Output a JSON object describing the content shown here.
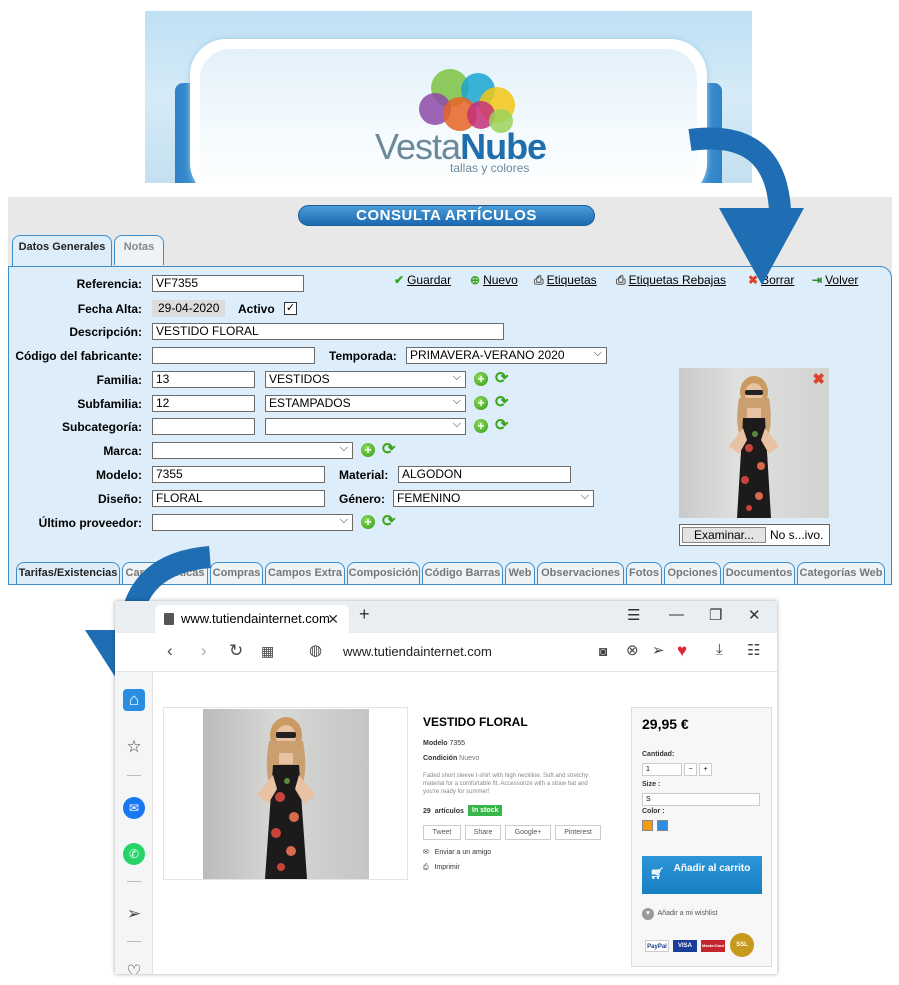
{
  "banner": {
    "brand_part1": "Vesta",
    "brand_part2": "Nube",
    "tagline": "tallas y colores"
  },
  "erp": {
    "title": "CONSULTA ARTÍCULOS",
    "tabs": [
      "Datos Generales",
      "Notas"
    ],
    "toolbar": {
      "guardar": "Guardar",
      "nuevo": "Nuevo",
      "etiquetas": "Etiquetas",
      "etiquetas_rebajas": "Etiquetas Rebajas",
      "borrar": "Borrar",
      "volver": "Volver"
    },
    "labels": {
      "referencia": "Referencia:",
      "fecha_alta": "Fecha Alta:",
      "activo": "Activo",
      "descripcion": "Descripción:",
      "codigo_fabricante": "Código del fabricante:",
      "temporada": "Temporada:",
      "familia": "Familia:",
      "subfamilia": "Subfamilia:",
      "subcategoria": "Subcategoría:",
      "marca": "Marca:",
      "modelo": "Modelo:",
      "material": "Material:",
      "diseno": "Diseño:",
      "genero": "Género:",
      "ultimo_proveedor": "Último proveedor:"
    },
    "values": {
      "referencia": "VF7355",
      "fecha_alta": "29-04-2020",
      "activo_checked": "✓",
      "descripcion": "VESTIDO FLORAL",
      "codigo_fabricante": "",
      "temporada": "PRIMAVERA-VERANO 2020",
      "familia_code": "13",
      "familia": "VESTIDOS",
      "subfamilia_code": "12",
      "subfamilia": "ESTAMPADOS",
      "subcategoria_code": "",
      "subcategoria": "",
      "marca": "",
      "modelo": "7355",
      "material": "ALGODON",
      "diseno": "FLORAL",
      "genero": "FEMENINO",
      "ultimo_proveedor": ""
    },
    "file": {
      "button": "Examinar...",
      "status": "No s...ivo."
    },
    "bottom_tabs": [
      "Tarifas/Existencias",
      "Características",
      "Compras",
      "Campos Extra",
      "Composición",
      "Código Barras",
      "Web",
      "Observaciones",
      "Fotos",
      "Opciones",
      "Documentos",
      "Categorías Web"
    ]
  },
  "browser": {
    "tab_title": "www.tutiendainternet.com",
    "url": "www.tutiendainternet.com",
    "product": {
      "title": "VESTIDO FLORAL",
      "modelo_label": "Modelo",
      "modelo_value": "7355",
      "condicion_label": "Condición",
      "condicion_value": "Nuevo",
      "description": "Faded short sleeve t-shirt with high neckline. Soft and stretchy material for a comfortable fit. Accessorize with a straw hat and you're ready for summer!",
      "stock_count": "29",
      "stock_word": "artículos",
      "stock_badge": "In stock",
      "social": [
        "Tweet",
        "Share",
        "Google+",
        "Pinterest"
      ],
      "send_friend": "Enviar a un amigo",
      "print": "Imprimir"
    },
    "buy": {
      "price": "29,95 €",
      "cantidad_label": "Cantidad:",
      "cantidad_value": "1",
      "size_label": "Size :",
      "size_value": "S",
      "color_label": "Color :",
      "colors": [
        "#f39c12",
        "#2e8ee0"
      ],
      "cart_button": "Añadir al carrito",
      "wishlist": "Añadir a mi wishlist",
      "cards": [
        "PayPal",
        "VISA",
        "MasterCard",
        "SSL"
      ]
    }
  }
}
